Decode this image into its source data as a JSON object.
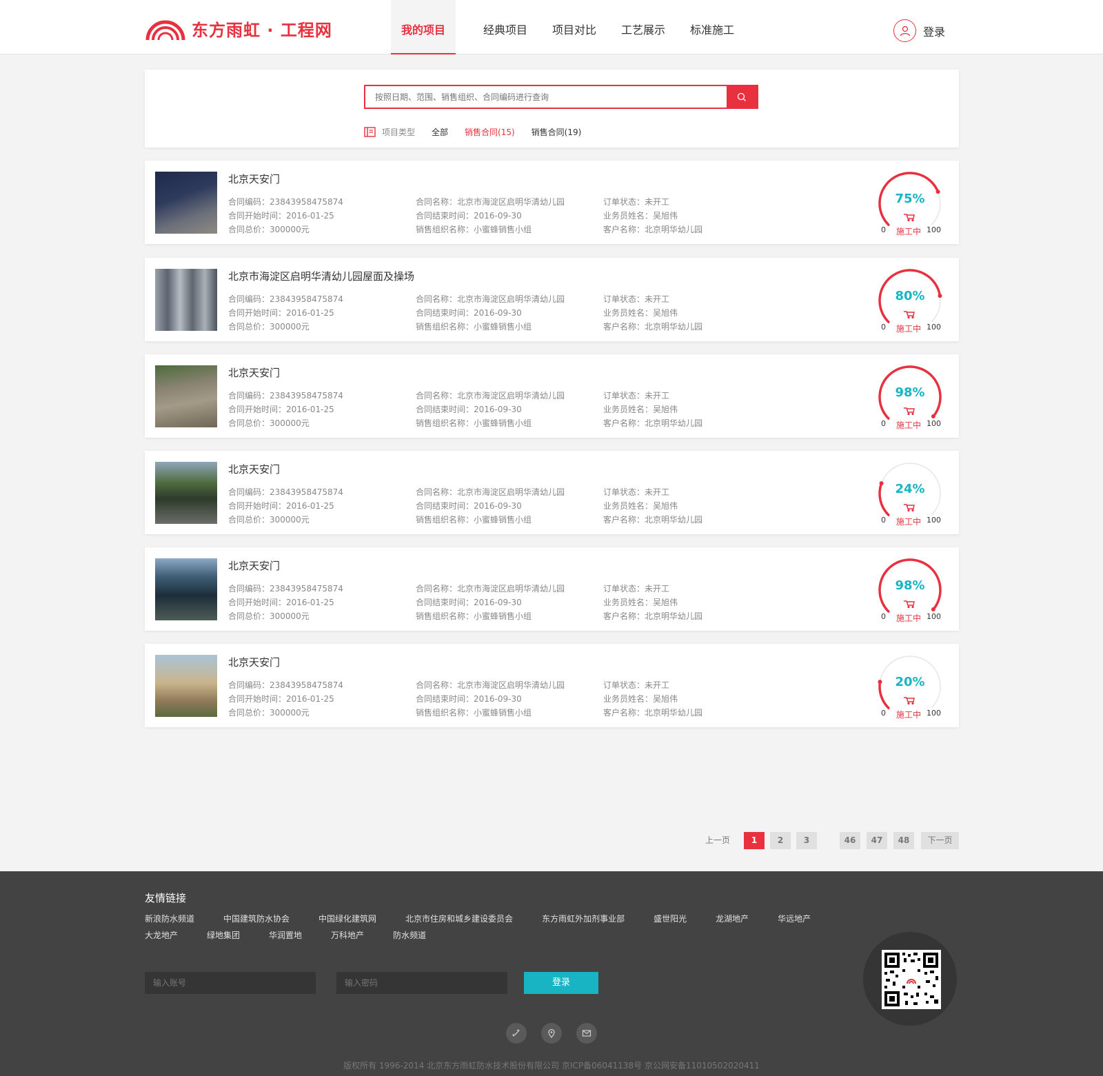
{
  "header": {
    "logo_text": "东方雨虹 · 工程网",
    "nav": [
      {
        "label": "我的项目",
        "active": true
      },
      {
        "label": "经典项目"
      },
      {
        "label": "项目对比"
      },
      {
        "label": "工艺展示"
      },
      {
        "label": "标准施工"
      }
    ],
    "login_label": "登录",
    "accent_color": "#e8303e"
  },
  "search": {
    "placeholder": "按照日期、范围、销售组织、合同编码进行查询",
    "filter_label": "项目类型",
    "filters": [
      "全部",
      "销售合同(15)",
      "销售合同(19)"
    ],
    "active_filter": 1
  },
  "projects": [
    {
      "title": "北京天安门",
      "contract_no": "合同编码：23843958475874",
      "start": "合同开始时间：2016-01-25",
      "total": "合同总价：300000元",
      "name": "合同名称：北京市海淀区启明华清幼儿园",
      "end": "合同结束时间：2016-09-30",
      "org": "销售组织名称：小蜜蜂销售小组",
      "status": "订单状态：未开工",
      "salesman": "业务员姓名：吴旭伟",
      "customer": "客户名称：北京明华幼儿园",
      "progress": 75,
      "progress_label": "75%",
      "gauge_status": "施工中",
      "gauge_min": "0",
      "gauge_max": "100"
    },
    {
      "title": "北京市海淀区启明华清幼儿园屋面及操场",
      "contract_no": "合同编码：23843958475874",
      "start": "合同开始时间：2016-01-25",
      "total": "合同总价：300000元",
      "name": "合同名称：北京市海淀区启明华清幼儿园",
      "end": "合同结束时间：2016-09-30",
      "org": "销售组织名称：小蜜蜂销售小组",
      "status": "订单状态：未开工",
      "salesman": "业务员姓名：吴旭伟",
      "customer": "客户名称：北京明华幼儿园",
      "progress": 80,
      "progress_label": "80%",
      "gauge_status": "施工中",
      "gauge_min": "0",
      "gauge_max": "100"
    },
    {
      "title": "北京天安门",
      "contract_no": "合同编码：23843958475874",
      "start": "合同开始时间：2016-01-25",
      "total": "合同总价：300000元",
      "name": "合同名称：北京市海淀区启明华清幼儿园",
      "end": "合同结束时间：2016-09-30",
      "org": "销售组织名称：小蜜蜂销售小组",
      "status": "订单状态：未开工",
      "salesman": "业务员姓名：吴旭伟",
      "customer": "客户名称：北京明华幼儿园",
      "progress": 98,
      "progress_label": "98%",
      "gauge_status": "施工中",
      "gauge_min": "0",
      "gauge_max": "100"
    },
    {
      "title": "北京天安门",
      "contract_no": "合同编码：23843958475874",
      "start": "合同开始时间：2016-01-25",
      "total": "合同总价：300000元",
      "name": "合同名称：北京市海淀区启明华清幼儿园",
      "end": "合同结束时间：2016-09-30",
      "org": "销售组织名称：小蜜蜂销售小组",
      "status": "订单状态：未开工",
      "salesman": "业务员姓名：吴旭伟",
      "customer": "客户名称：北京明华幼儿园",
      "progress": 24,
      "progress_label": "24%",
      "gauge_status": "施工中",
      "gauge_min": "0",
      "gauge_max": "100"
    },
    {
      "title": "北京天安门",
      "contract_no": "合同编码：23843958475874",
      "start": "合同开始时间：2016-01-25",
      "total": "合同总价：300000元",
      "name": "合同名称：北京市海淀区启明华清幼儿园",
      "end": "合同结束时间：2016-09-30",
      "org": "销售组织名称：小蜜蜂销售小组",
      "status": "订单状态：未开工",
      "salesman": "业务员姓名：吴旭伟",
      "customer": "客户名称：北京明华幼儿园",
      "progress": 98,
      "progress_label": "98%",
      "gauge_status": "施工中",
      "gauge_min": "0",
      "gauge_max": "100"
    },
    {
      "title": "北京天安门",
      "contract_no": "合同编码：23843958475874",
      "start": "合同开始时间：2016-01-25",
      "total": "合同总价：300000元",
      "name": "合同名称：北京市海淀区启明华清幼儿园",
      "end": "合同结束时间：2016-09-30",
      "org": "销售组织名称：小蜜蜂销售小组",
      "status": "订单状态：未开工",
      "salesman": "业务员姓名：吴旭伟",
      "customer": "客户名称：北京明华幼儿园",
      "progress": 20,
      "progress_label": "20%",
      "gauge_status": "施工中",
      "gauge_min": "0",
      "gauge_max": "100"
    }
  ],
  "pagination": {
    "prev": "上一页",
    "pages": [
      "1",
      "2",
      "3",
      "46",
      "47",
      "48"
    ],
    "current": "1",
    "next": "下一页"
  },
  "footer": {
    "links_title": "友情链接",
    "links_row1": [
      "新浪防水频道",
      "中国建筑防水协会",
      "中国绿化建筑网",
      "北京市住房和城乡建设委员会",
      "东方雨虹外加剂事业部",
      "盛世阳光",
      "龙湖地产",
      "华远地产"
    ],
    "links_row2": [
      "大龙地产",
      "绿地集团",
      "华润置地",
      "万科地产",
      "防水频道"
    ],
    "account_placeholder": "输入账号",
    "password_placeholder": "输入密码",
    "login_button": "登录",
    "icons": [
      "phone-icon",
      "location-icon",
      "mail-icon"
    ],
    "copyright": "版权所有 1996-2014 北京东方雨虹防水技术股份有限公司   京ICP备06041138号   京公网安备11010502020411"
  },
  "colors": {
    "accent": "#e8303e",
    "teal": "#18b4c4",
    "footer_bg": "#434343"
  }
}
